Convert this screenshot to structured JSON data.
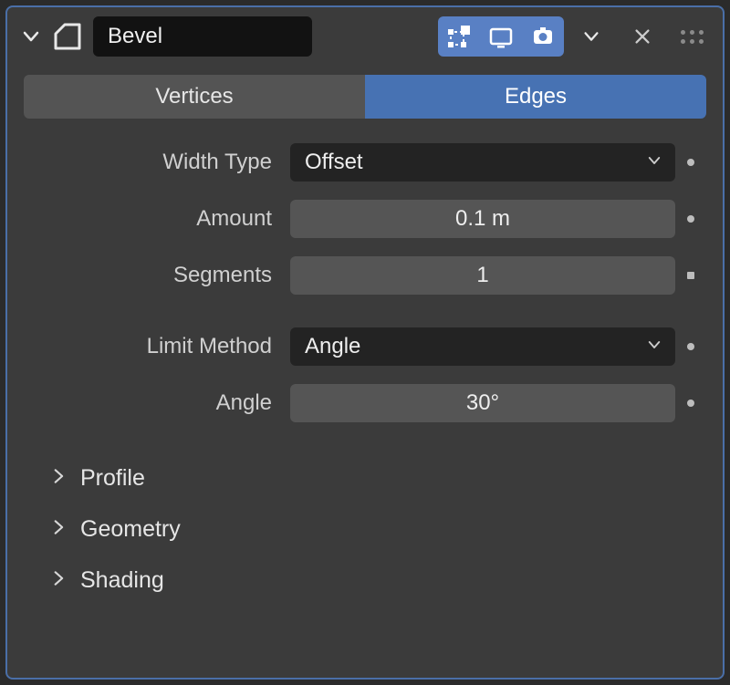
{
  "header": {
    "modifier_name": "Bevel"
  },
  "tabs": {
    "inactive": "Vertices",
    "active": "Edges"
  },
  "props": {
    "width_type_label": "Width Type",
    "width_type_value": "Offset",
    "amount_label": "Amount",
    "amount_value": "0.1 m",
    "segments_label": "Segments",
    "segments_value": "1",
    "limit_method_label": "Limit Method",
    "limit_method_value": "Angle",
    "angle_label": "Angle",
    "angle_value": "30°"
  },
  "subpanels": {
    "profile": "Profile",
    "geometry": "Geometry",
    "shading": "Shading"
  }
}
